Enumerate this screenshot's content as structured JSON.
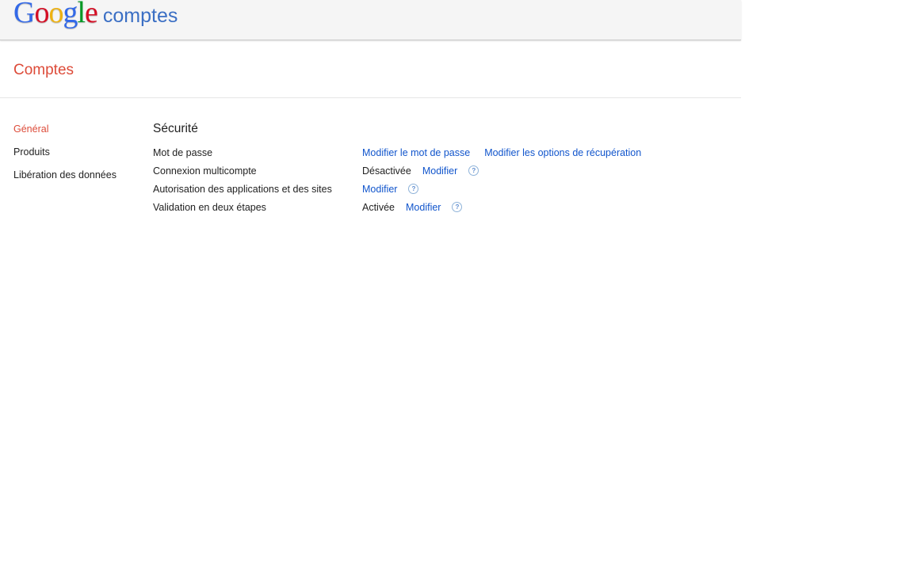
{
  "header": {
    "logo_letters": [
      {
        "char": "G",
        "color": "#3369e8"
      },
      {
        "char": "o",
        "color": "#d50f25"
      },
      {
        "char": "o",
        "color": "#eeb211"
      },
      {
        "char": "g",
        "color": "#3369e8"
      },
      {
        "char": "l",
        "color": "#009925"
      },
      {
        "char": "e",
        "color": "#d50f25"
      }
    ],
    "product_name": "comptes"
  },
  "page_title": "Comptes",
  "sidebar": {
    "items": [
      {
        "label": "Général",
        "active": true
      },
      {
        "label": "Produits",
        "active": false
      },
      {
        "label": "Libération des données",
        "active": false
      }
    ]
  },
  "security": {
    "title": "Sécurité",
    "rows": {
      "password": {
        "label": "Mot de passe",
        "link_change_password": "Modifier le mot de passe",
        "link_recovery_options": "Modifier les options de récupération"
      },
      "multi_login": {
        "label": "Connexion multicompte",
        "status": "Désactivée",
        "link_modify": "Modifier",
        "help": "?"
      },
      "app_authorization": {
        "label": "Autorisation des applications et des sites",
        "link_modify": "Modifier",
        "help": "?"
      },
      "two_step": {
        "label": "Validation en deux étapes",
        "status": "Activée",
        "link_modify": "Modifier",
        "help": "?"
      }
    }
  },
  "colors": {
    "accent_red": "#dd4b39",
    "link_blue": "#1155cc",
    "product_blue": "#3b6fc4"
  },
  "icons": {
    "help": "help-circle-icon"
  }
}
